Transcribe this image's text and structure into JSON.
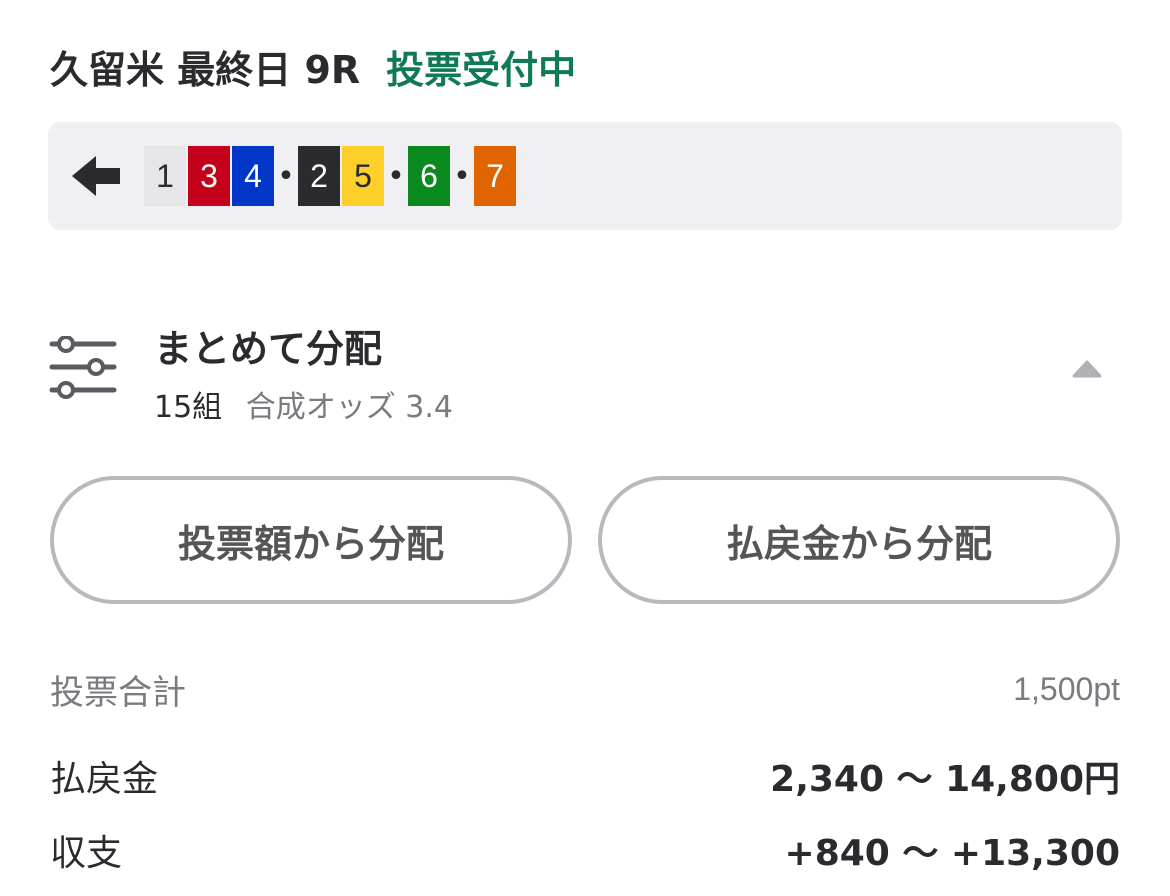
{
  "header": {
    "race_title": "久留米 最終日 9R",
    "status": "投票受付中",
    "status_color": "#0f7a55"
  },
  "combination": {
    "back_icon": "arrow-left-icon",
    "chips": [
      {
        "number": "1",
        "bg": "#e6e6ea",
        "fg": "#2b2b2f"
      },
      {
        "number": "3",
        "bg": "#c4001a",
        "fg": "#ffffff"
      },
      {
        "number": "4",
        "bg": "#0037c8",
        "fg": "#ffffff"
      },
      {
        "number": "2",
        "bg": "#2b2b2f",
        "fg": "#ffffff"
      },
      {
        "number": "5",
        "bg": "#ffd02a",
        "fg": "#2b2b2f"
      },
      {
        "number": "6",
        "bg": "#0a8a1e",
        "fg": "#ffffff"
      },
      {
        "number": "7",
        "bg": "#e06400",
        "fg": "#ffffff"
      }
    ],
    "separator": "•"
  },
  "distribution": {
    "icon": "sliders-icon",
    "title": "まとめて分配",
    "count": "15組",
    "odds": "合成オッズ 3.4",
    "toggle_icon": "chevron-up-icon"
  },
  "buttons": {
    "by_stake": "投票額から分配",
    "by_payout": "払戻金から分配"
  },
  "summary": {
    "total_label": "投票合計",
    "total_value": "1,500pt",
    "payout_label": "払戻金",
    "payout_value": "2,340 ～ 14,800円",
    "balance_label": "収支",
    "balance_value": "+840 ～ +13,300"
  }
}
